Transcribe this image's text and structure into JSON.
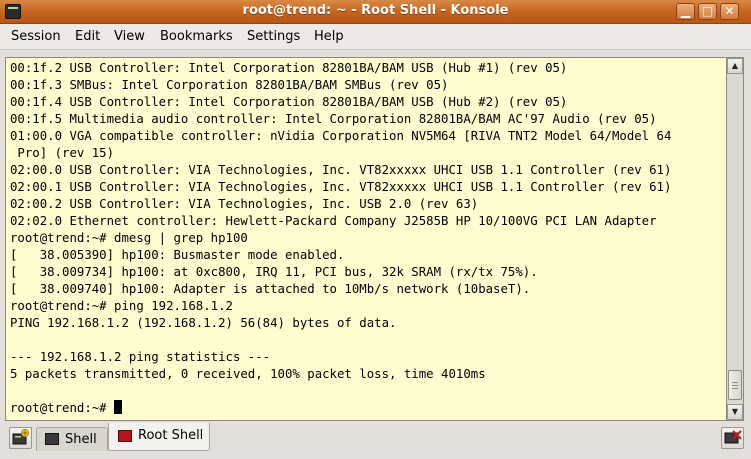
{
  "window": {
    "title": "root@trend: ~ - Root Shell - Konsole",
    "buttons": {
      "minimize": "▁",
      "maximize": "□",
      "close": "✕"
    }
  },
  "menu": [
    "Session",
    "Edit",
    "View",
    "Bookmarks",
    "Settings",
    "Help"
  ],
  "terminal": {
    "lines": [
      "00:1f.2 USB Controller: Intel Corporation 82801BA/BAM USB (Hub #1) (rev 05)",
      "00:1f.3 SMBus: Intel Corporation 82801BA/BAM SMBus (rev 05)",
      "00:1f.4 USB Controller: Intel Corporation 82801BA/BAM USB (Hub #2) (rev 05)",
      "00:1f.5 Multimedia audio controller: Intel Corporation 82801BA/BAM AC'97 Audio (rev 05)",
      "01:00.0 VGA compatible controller: nVidia Corporation NV5M64 [RIVA TNT2 Model 64/Model 64",
      " Pro] (rev 15)",
      "02:00.0 USB Controller: VIA Technologies, Inc. VT82xxxxx UHCI USB 1.1 Controller (rev 61)",
      "02:00.1 USB Controller: VIA Technologies, Inc. VT82xxxxx UHCI USB 1.1 Controller (rev 61)",
      "02:00.2 USB Controller: VIA Technologies, Inc. USB 2.0 (rev 63)",
      "02:02.0 Ethernet controller: Hewlett-Packard Company J2585B HP 10/100VG PCI LAN Adapter",
      "root@trend:~# dmesg | grep hp100",
      "[   38.005390] hp100: Busmaster mode enabled.",
      "[   38.009734] hp100: at 0xc800, IRQ 11, PCI bus, 32k SRAM (rx/tx 75%).",
      "[   38.009740] hp100: Adapter is attached to 10Mb/s network (10baseT).",
      "root@trend:~# ping 192.168.1.2",
      "PING 192.168.1.2 (192.168.1.2) 56(84) bytes of data.",
      "",
      "--- 192.168.1.2 ping statistics ---",
      "5 packets transmitted, 0 received, 100% packet loss, time 4010ms",
      ""
    ],
    "prompt": "root@trend:~# ",
    "background": "#fffdd0",
    "foreground": "#000000"
  },
  "scrollbar": {
    "position": 1.0
  },
  "tabs": [
    {
      "label": "Shell",
      "icon": "terminal-icon",
      "active": false
    },
    {
      "label": "Root Shell",
      "icon": "root-terminal-icon",
      "active": true
    }
  ],
  "colors": {
    "titlebar": "#c4621d",
    "accent": "#d98a45"
  }
}
